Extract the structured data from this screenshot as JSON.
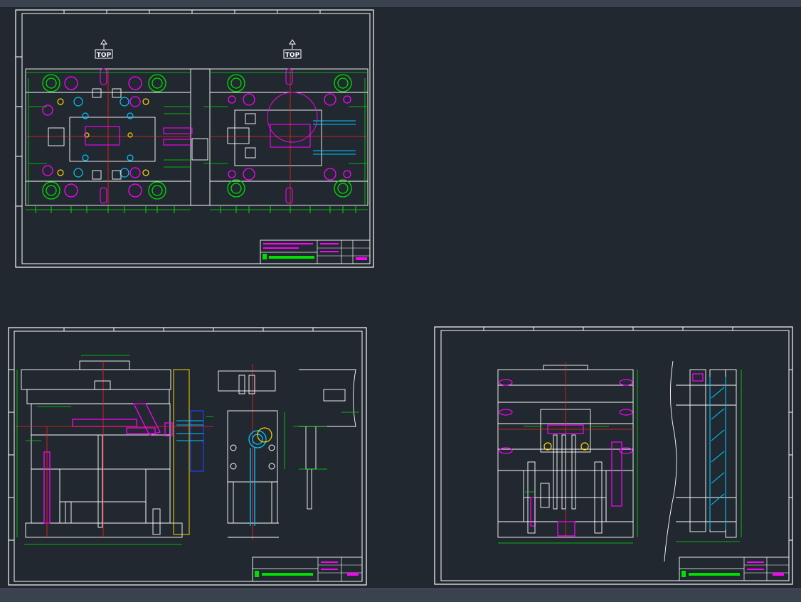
{
  "top_label_1": "TOP",
  "top_label_2": "TOP",
  "colors": {
    "background": "#212830",
    "frame": "#ffffff",
    "green": "#00e000",
    "magenta": "#ff00ff",
    "red": "#ff2020",
    "cyan": "#00c8ff",
    "yellow": "#ffd800",
    "blue": "#2040ff"
  }
}
